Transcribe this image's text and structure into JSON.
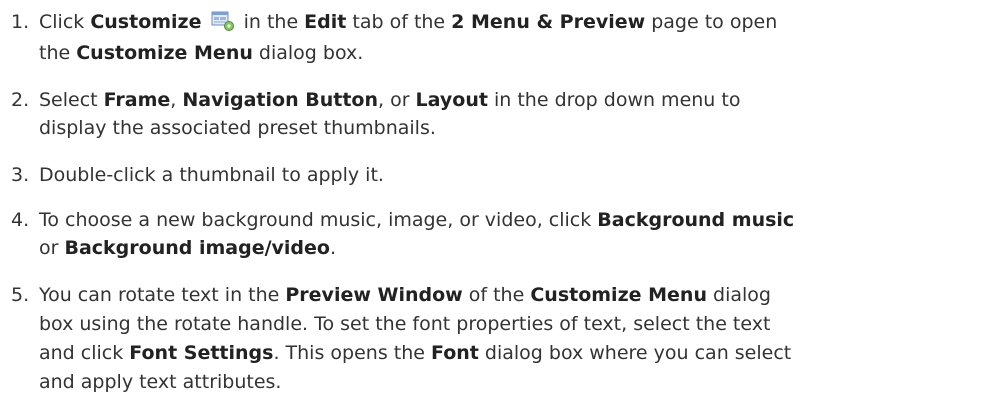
{
  "steps": [
    {
      "number": "1.",
      "line1": [
        {
          "t": "Click ",
          "b": false
        },
        {
          "t": "Customize",
          "b": true
        },
        {
          "icon": "customize-icon"
        },
        {
          "t": " in the ",
          "b": false
        },
        {
          "t": "Edit",
          "b": true
        },
        {
          "t": " tab of the ",
          "b": false
        },
        {
          "t": "2 Menu & Preview",
          "b": true
        },
        {
          "t": " page to open",
          "b": false
        }
      ],
      "line2": [
        {
          "t": "the ",
          "b": false
        },
        {
          "t": "Customize Menu",
          "b": true
        },
        {
          "t": " dialog box.",
          "b": false
        }
      ]
    },
    {
      "number": "2.",
      "line1": [
        {
          "t": "Select ",
          "b": false
        },
        {
          "t": "Frame",
          "b": true
        },
        {
          "t": ", ",
          "b": false
        },
        {
          "t": "Navigation Button",
          "b": true
        },
        {
          "t": ", or ",
          "b": false
        },
        {
          "t": "Layout",
          "b": true
        },
        {
          "t": " in the drop down menu to",
          "b": false
        }
      ],
      "line2": [
        {
          "t": "display the associated preset thumbnails.",
          "b": false
        }
      ]
    },
    {
      "number": "3.",
      "line1": [
        {
          "t": "Double-click a thumbnail to apply it.",
          "b": false
        }
      ]
    },
    {
      "number": "4.",
      "line1": [
        {
          "t": "To choose a new background music, image, or video, click ",
          "b": false
        },
        {
          "t": "Background music",
          "b": true
        }
      ],
      "line2": [
        {
          "t": "or ",
          "b": false
        },
        {
          "t": "Background image/video",
          "b": true
        },
        {
          "t": ".",
          "b": false
        }
      ]
    },
    {
      "number": "5.",
      "line1": [
        {
          "t": "You can rotate text in the ",
          "b": false
        },
        {
          "t": "Preview Window",
          "b": true
        },
        {
          "t": " of the ",
          "b": false
        },
        {
          "t": "Customize Menu",
          "b": true
        },
        {
          "t": " dialog",
          "b": false
        }
      ],
      "line2": [
        {
          "t": "box using the rotate handle. To set the font properties of text, select the text",
          "b": false
        }
      ],
      "line3": [
        {
          "t": "and click ",
          "b": false
        },
        {
          "t": "Font Settings",
          "b": true
        },
        {
          "t": ". This opens the ",
          "b": false
        },
        {
          "t": "Font",
          "b": true
        },
        {
          "t": " dialog box where you can select",
          "b": false
        }
      ],
      "line4": [
        {
          "t": "and apply text attributes.",
          "b": false
        }
      ]
    }
  ]
}
